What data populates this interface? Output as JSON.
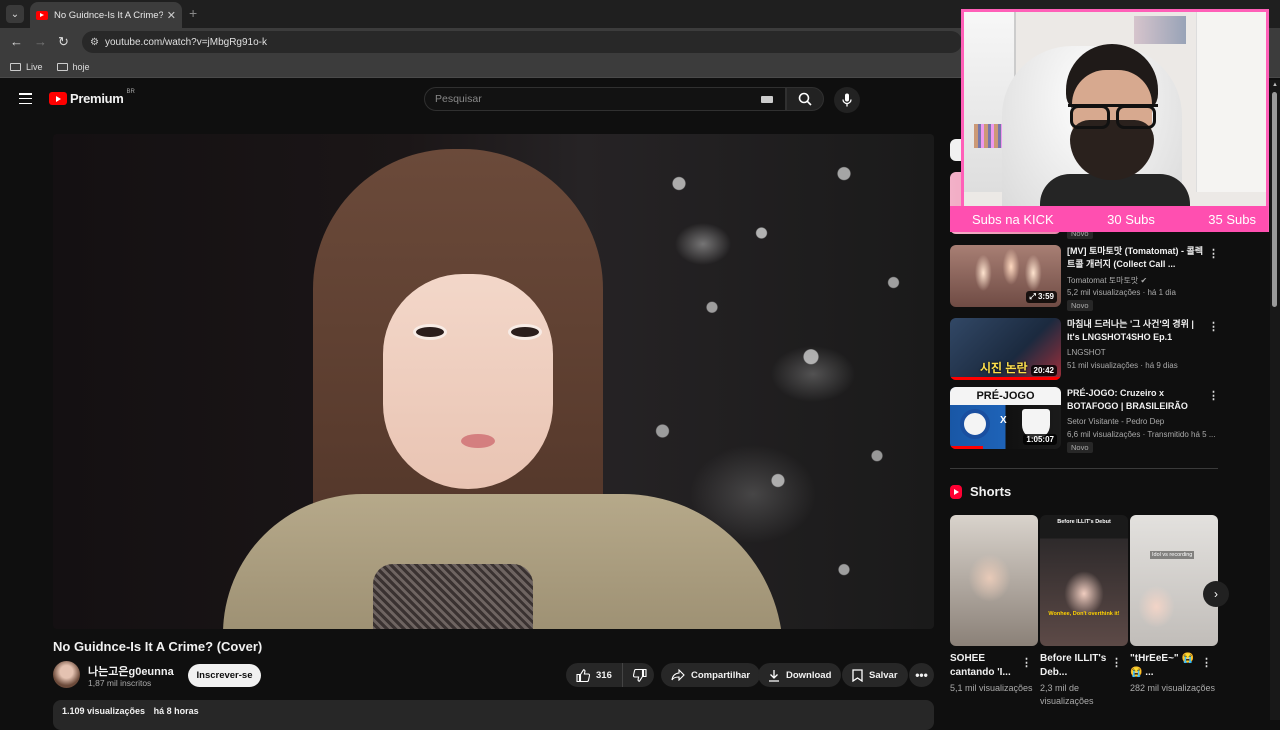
{
  "browser": {
    "tab_title": "No Guidnce-Is It A Crime? (Cov",
    "tab_close": "✕",
    "new_tab": "+",
    "url": "youtube.com/watch?v=jMbgRg91o-k",
    "bookmarks": [
      "Live",
      "hoje"
    ]
  },
  "header": {
    "logo_text": "Premium",
    "country": "BR",
    "search_placeholder": "Pesquisar"
  },
  "video": {
    "title": "No Guidnce-Is It A Crime? (Cover)",
    "channel_name": "나는고은g0eunna",
    "channel_subs": "1,87 mil inscritos",
    "subscribe_label": "Inscrever-se",
    "likes": "316",
    "share_label": "Compartilhar",
    "download_label": "Download",
    "save_label": "Salvar",
    "views": "1.109 visualizações",
    "age": "há 8 horas"
  },
  "recommendations": [
    {
      "title": "[MV] 토마토맛 (Tomatomat) - 콜렉트콜 개러지 (Collect Call ...",
      "channel": "Tomatomat 토마토맛 ✔",
      "meta": "5,2 mil visualizações · há 1 dia",
      "duration": "3:59",
      "badge": "Novo"
    },
    {
      "title": "마침내 드러나는 '그 사건'의 경위 | It's LNGSHOT4SHO Ep.1",
      "channel": "LNGSHOT",
      "meta": "51 mil visualizações · há 9 dias",
      "duration": "20:42",
      "thumb_text": "시진 논란"
    },
    {
      "title": "PRÉ-JOGO: Cruzeiro x BOTAFOGO | BRASILEIRÃO",
      "channel": "Setor Visitante - Pedro Dep",
      "meta": "6,6 mil visualizações · Transmitido há 5 ...",
      "duration": "1:05:07",
      "badge": "Novo",
      "thumb_head": "PRÉ-JOGO",
      "thumb_x": "X"
    }
  ],
  "partial_rec_badge": "Novo",
  "shorts": {
    "heading": "Shorts",
    "items": [
      {
        "title": "SOHEE cantando 'I...",
        "views": "5,1 mil visualizações"
      },
      {
        "title": "Before ILLIT's Deb...",
        "views": "2,3 mil de visualizações",
        "cap1": "Before ILLIT's Debut",
        "cap2": "Wonhee, Don't overthink it!"
      },
      {
        "title": "\"tHrEeE~\" 😭😭 ...",
        "views": "282 mil visualizações",
        "cap": "Idol vs recording"
      }
    ]
  },
  "overlay": {
    "kick_label": "Subs na KICK",
    "subs_a": "30 Subs",
    "subs_b": "35 Subs"
  },
  "colors": {
    "accent_red": "#ff0000",
    "overlay_pink": "#ff4fb0"
  }
}
